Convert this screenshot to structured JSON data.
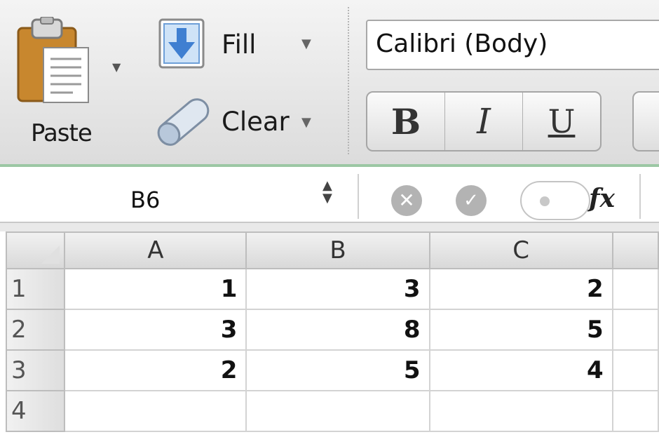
{
  "ribbon": {
    "paste_label": "Paste",
    "fill_label": "Fill",
    "clear_label": "Clear",
    "font_name": "Calibri (Body)",
    "bold_label": "B",
    "italic_label": "I",
    "underline_label": "U"
  },
  "formula_bar": {
    "name_box": "B6",
    "fx_label": "fx"
  },
  "grid": {
    "columns": [
      "A",
      "B",
      "C"
    ],
    "rows": [
      {
        "label": "1",
        "cells": [
          "1",
          "3",
          "2"
        ]
      },
      {
        "label": "2",
        "cells": [
          "3",
          "8",
          "5"
        ]
      },
      {
        "label": "3",
        "cells": [
          "2",
          "5",
          "4"
        ]
      },
      {
        "label": "4",
        "cells": [
          "",
          "",
          ""
        ]
      }
    ]
  },
  "colors": {
    "ribbon_bottom_border": "#9cc7a4",
    "button_icon_gray": "#b3b3b3",
    "fill_arrow_blue": "#3f7fd1"
  },
  "icons": [
    "clipboard-icon",
    "fill-down-icon",
    "eraser-icon",
    "cancel-icon",
    "enter-icon",
    "function-icon"
  ]
}
